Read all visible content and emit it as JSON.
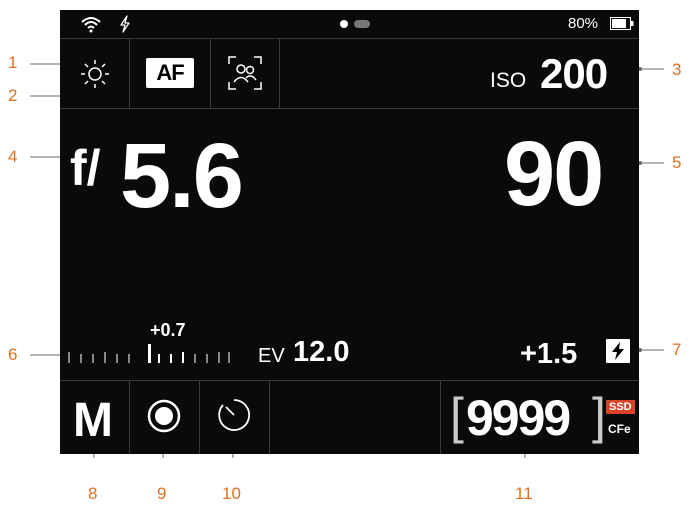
{
  "status": {
    "battery_percent": "80%"
  },
  "top_row": {
    "af_label": "AF",
    "iso_label": "ISO",
    "iso_value": "200"
  },
  "exposure": {
    "f_prefix": "f/",
    "aperture": "5.6",
    "shutter": "90"
  },
  "meter": {
    "offset": "+0.7",
    "ev_label": "EV",
    "ev_value": "12.0",
    "flash_comp": "+1.5"
  },
  "bottom_row": {
    "mode": "M",
    "shots_remaining": "9999",
    "media_primary": "SSD",
    "media_secondary": "CFe"
  },
  "callouts": [
    "1",
    "2",
    "3",
    "4",
    "5",
    "6",
    "7",
    "8",
    "9",
    "10",
    "11"
  ],
  "colors": {
    "accent": "#e0701e",
    "screen_bg": "#0a0a0a",
    "ssd_badge": "#d9432a"
  },
  "icons": [
    "wifi-icon",
    "flash-bolt-icon",
    "page-indicator",
    "battery-icon",
    "brightness-icon",
    "face-detect-icon",
    "flash-icon",
    "record-icon",
    "self-timer-icon"
  ]
}
